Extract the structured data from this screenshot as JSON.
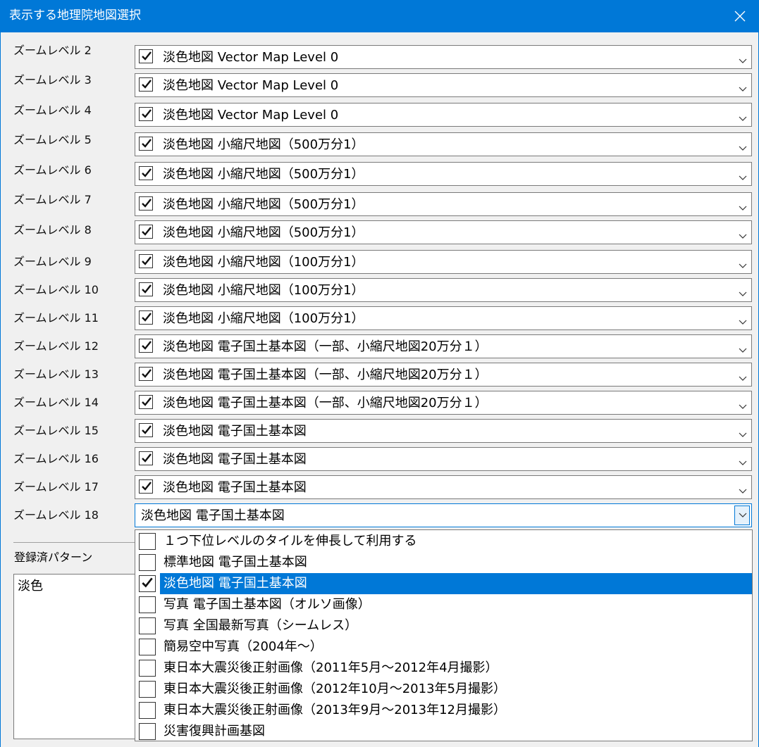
{
  "window": {
    "title": "表示する地理院地図選択",
    "close_icon": "close-icon"
  },
  "zoom_rows": [
    {
      "label": "ズームレベル 2",
      "value": "淡色地図 Vector Map Level 0",
      "checked": true
    },
    {
      "label": "ズームレベル 3",
      "value": "淡色地図 Vector Map Level 0",
      "checked": true
    },
    {
      "label": "ズームレベル 4",
      "value": "淡色地図 Vector Map Level 0",
      "checked": true
    },
    {
      "label": "ズームレベル 5",
      "value": "淡色地図 小縮尺地図（500万分1）",
      "checked": true
    },
    {
      "label": "ズームレベル 6",
      "value": "淡色地図 小縮尺地図（500万分1）",
      "checked": true
    },
    {
      "label": "ズームレベル 7",
      "value": "淡色地図 小縮尺地図（500万分1）",
      "checked": true
    },
    {
      "label": "ズームレベル 8",
      "value": "淡色地図 小縮尺地図（500万分1）",
      "checked": true
    },
    {
      "label": "ズームレベル 9",
      "value": "淡色地図 小縮尺地図（100万分1）",
      "checked": true
    },
    {
      "label": "ズームレベル 10",
      "value": "淡色地図 小縮尺地図（100万分1）",
      "checked": true
    },
    {
      "label": "ズームレベル 11",
      "value": "淡色地図 小縮尺地図（100万分1）",
      "checked": true
    },
    {
      "label": "ズームレベル 12",
      "value": "淡色地図 電子国土基本図（一部、小縮尺地図20万分１）",
      "checked": true
    },
    {
      "label": "ズームレベル 13",
      "value": "淡色地図 電子国土基本図（一部、小縮尺地図20万分１）",
      "checked": true
    },
    {
      "label": "ズームレベル 14",
      "value": "淡色地図 電子国土基本図（一部、小縮尺地図20万分１）",
      "checked": true
    },
    {
      "label": "ズームレベル 15",
      "value": "淡色地図 電子国土基本図",
      "checked": true
    },
    {
      "label": "ズームレベル 16",
      "value": "淡色地図 電子国土基本図",
      "checked": true
    },
    {
      "label": "ズームレベル 17",
      "value": "淡色地図 電子国土基本図",
      "checked": true
    },
    {
      "label": "ズームレベル 18",
      "value": "淡色地図 電子国土基本図",
      "checked": false
    }
  ],
  "registered": {
    "label": "登録済パターン",
    "items": [
      "淡色"
    ]
  },
  "dropdown": {
    "items": [
      {
        "label": "１つ下位レベルのタイルを伸長して利用する",
        "checked": false,
        "selected": false
      },
      {
        "label": "標準地図 電子国土基本図",
        "checked": false,
        "selected": false
      },
      {
        "label": "淡色地図 電子国土基本図",
        "checked": true,
        "selected": true
      },
      {
        "label": "写真 電子国土基本図（オルソ画像）",
        "checked": false,
        "selected": false
      },
      {
        "label": "写真 全国最新写真（シームレス）",
        "checked": false,
        "selected": false
      },
      {
        "label": "簡易空中写真（2004年～）",
        "checked": false,
        "selected": false
      },
      {
        "label": "東日本大震災後正射画像（2011年5月～2012年4月撮影）",
        "checked": false,
        "selected": false
      },
      {
        "label": "東日本大震災後正射画像（2012年10月～2013年5月撮影）",
        "checked": false,
        "selected": false
      },
      {
        "label": "東日本大震災後正射画像（2013年9月～2013年12月撮影）",
        "checked": false,
        "selected": false
      },
      {
        "label": "災害復興計画基図",
        "checked": false,
        "selected": false
      }
    ]
  },
  "colors": {
    "accent": "#0078d7",
    "selection": "#0078d7"
  }
}
